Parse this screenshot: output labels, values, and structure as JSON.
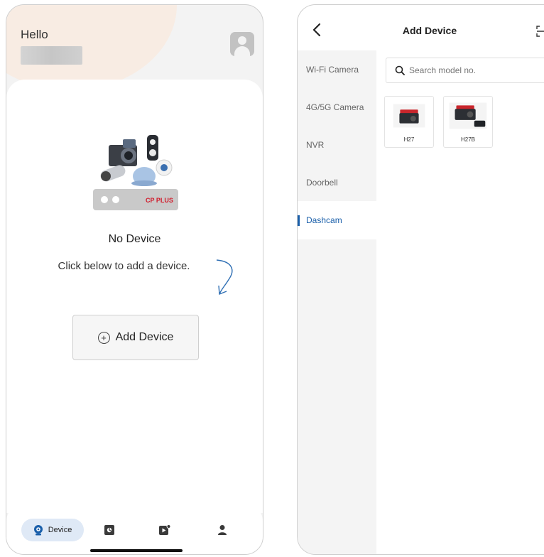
{
  "home": {
    "greeting": "Hello",
    "empty_title": "No Device",
    "empty_hint": "Click below to add a device.",
    "add_button_label": "Add Device",
    "brand_logo_text": "CP PLUS",
    "tabs": [
      {
        "label": "Device",
        "icon": "device-camera-icon",
        "active": true
      },
      {
        "label": "",
        "icon": "gallery-icon"
      },
      {
        "label": "",
        "icon": "playback-icon"
      },
      {
        "label": "",
        "icon": "profile-icon"
      }
    ]
  },
  "add_device": {
    "title": "Add Device",
    "categories": [
      {
        "label": "Wi-Fi Camera",
        "active": false
      },
      {
        "label": "4G/5G Camera",
        "active": false
      },
      {
        "label": "NVR",
        "active": false
      },
      {
        "label": "Doorbell",
        "active": false
      },
      {
        "label": "Dashcam",
        "active": true
      }
    ],
    "search_placeholder": "Search model no.",
    "products": [
      {
        "label": "H27"
      },
      {
        "label": "H27B"
      }
    ]
  },
  "colors": {
    "accent": "#1a5faa",
    "active_tab_bg": "#dfe9f6",
    "peach": "#f8ece3",
    "brand_red": "#d11a2a"
  }
}
